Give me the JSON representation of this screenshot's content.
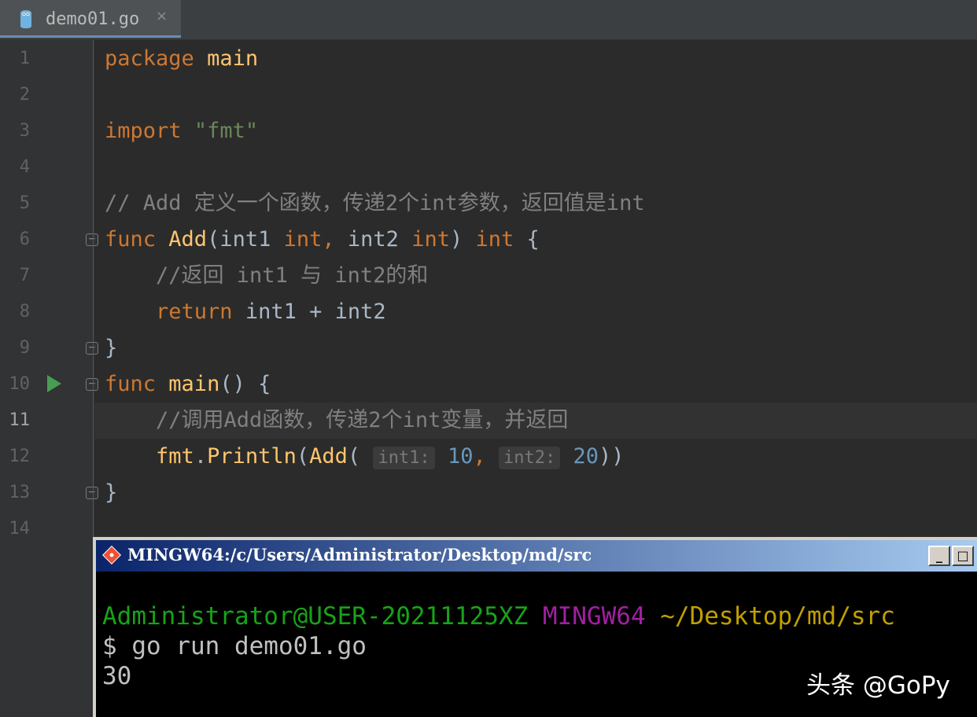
{
  "editor": {
    "tab": {
      "filename": "demo01.go",
      "icon": "go-file-icon",
      "close": "×"
    },
    "current_line": 11,
    "line_numbers": [
      "1",
      "2",
      "3",
      "4",
      "5",
      "6",
      "7",
      "8",
      "9",
      "10",
      "11",
      "12",
      "13",
      "14"
    ],
    "lines": {
      "l1": {
        "kw": "package",
        "name": "main"
      },
      "l3": {
        "kw": "import",
        "str": "\"fmt\""
      },
      "l5": {
        "comment": "// Add 定义一个函数，传递2个int参数，返回值是int"
      },
      "l6": {
        "kw": "func",
        "fn": "Add",
        "p1": "(int1 ",
        "t1": "int,",
        "p2": " int2 ",
        "t2": "int",
        "p3": ") ",
        "ret": "int",
        "brace": " {"
      },
      "l7": {
        "comment": "//返回 int1 与 int2的和"
      },
      "l8": {
        "kw": "return",
        "expr": " int1 + int2"
      },
      "l9": {
        "brace": "}"
      },
      "l10": {
        "kw": "func",
        "fn": "main",
        "rest": "() {"
      },
      "l11": {
        "comment": "//调用Add函数，传递2个int变量，并返回"
      },
      "l12": {
        "pkg": "fmt",
        "dot": ".",
        "call": "Println",
        "open": "(",
        "call2": "Add",
        "open2": "(",
        "hint1": "int1:",
        "arg1": "10",
        "comma": ",",
        "hint2": "int2:",
        "arg2": "20",
        "close": "))"
      },
      "l13": {
        "brace": "}"
      }
    }
  },
  "terminal": {
    "title": "MINGW64:/c/Users/Administrator/Desktop/md/src",
    "buttons": {
      "minimize": "_",
      "maximize": "□"
    },
    "prompt_user": "Administrator@USER-20211125XZ",
    "prompt_system": "MINGW64",
    "prompt_path": "~/Desktop/md/src",
    "command": "$ go run demo01.go",
    "output": "30"
  },
  "watermark": "头条 @GoPy"
}
